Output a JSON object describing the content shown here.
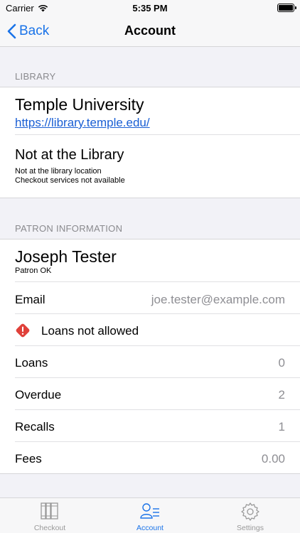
{
  "status_bar": {
    "carrier": "Carrier",
    "time": "5:35 PM"
  },
  "nav": {
    "back_label": "Back",
    "title": "Account"
  },
  "library": {
    "header": "LIBRARY",
    "name": "Temple University",
    "url": "https://library.temple.edu/",
    "location_status": "Not at the Library",
    "location_detail_1": "Not at the library location",
    "location_detail_2": "Checkout services not available"
  },
  "patron": {
    "header": "PATRON INFORMATION",
    "name": "Joseph Tester",
    "status": "Patron OK",
    "email_label": "Email",
    "email_value": "joe.tester@example.com",
    "warning": "Loans not allowed",
    "rows": [
      {
        "label": "Loans",
        "value": "0"
      },
      {
        "label": "Overdue",
        "value": "2"
      },
      {
        "label": "Recalls",
        "value": "1"
      },
      {
        "label": "Fees",
        "value": "0.00"
      }
    ]
  },
  "tabs": [
    {
      "label": "Checkout",
      "icon": "books-icon"
    },
    {
      "label": "Account",
      "icon": "user-list-icon"
    },
    {
      "label": "Settings",
      "icon": "gear-icon"
    }
  ],
  "colors": {
    "accent": "#1a73e8",
    "warning": "#e0413a"
  }
}
